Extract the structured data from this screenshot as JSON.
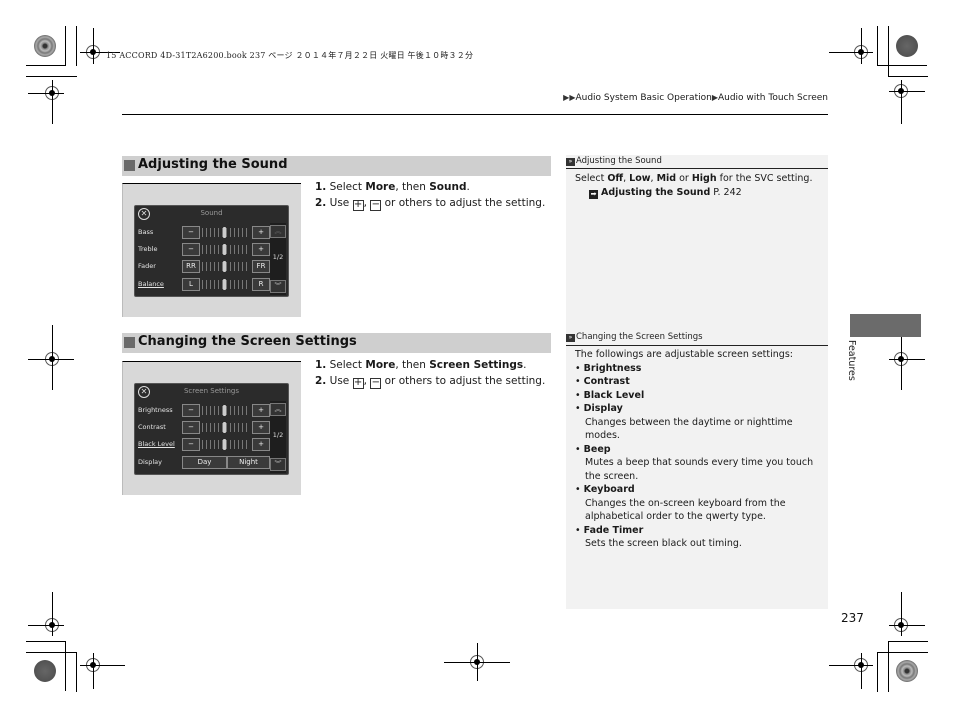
{
  "print_header": {
    "text": "15 ACCORD 4D-31T2A6200.book  237 ページ  ２０１４年７月２２日  火曜日  午後１０時３２分"
  },
  "breadcrumb": {
    "arrow": "▶",
    "items": [
      "Audio System Basic Operation",
      "Audio with Touch Screen"
    ]
  },
  "sections": [
    {
      "title": "Adjusting the Sound",
      "steps": [
        {
          "num": "1.",
          "pre": "Select ",
          "b1": "More",
          "mid": ", then ",
          "b2": "Sound",
          "post": "."
        },
        {
          "num": "2.",
          "pre": "Use ",
          "plus": "+",
          "sep": ", ",
          "minus": "−",
          "post": " or others to adjust the setting."
        }
      ],
      "screen": {
        "title": "Sound",
        "close_glyph": "✕",
        "rows": [
          {
            "label": "Bass",
            "left": "−",
            "right": "+"
          },
          {
            "label": "Treble",
            "left": "−",
            "right": "+"
          },
          {
            "label": "Fader",
            "left": "RR",
            "right": "FR"
          },
          {
            "label": "Balance",
            "left": "L",
            "right": "R"
          }
        ],
        "page": "1/2",
        "up": "︽",
        "down": "︾"
      }
    },
    {
      "title": "Changing the Screen Settings",
      "steps": [
        {
          "num": "1.",
          "pre": "Select ",
          "b1": "More",
          "mid": ", then ",
          "b2": "Screen Settings",
          "post": "."
        },
        {
          "num": "2.",
          "pre": "Use ",
          "plus": "+",
          "sep": ", ",
          "minus": "−",
          "post": " or others to adjust the setting."
        }
      ],
      "screen": {
        "title": "Screen Settings",
        "close_glyph": "✕",
        "rows": [
          {
            "label": "Brightness",
            "left": "−",
            "right": "+"
          },
          {
            "label": "Contrast",
            "left": "−",
            "right": "+"
          },
          {
            "label": "Black Level",
            "left": "−",
            "right": "+"
          }
        ],
        "display_row": {
          "label": "Display",
          "day": "Day",
          "night": "Night"
        },
        "page": "1/2",
        "up": "︽",
        "down": "︾"
      }
    }
  ],
  "notes": {
    "sound": {
      "head_icon": "»",
      "head": "Adjusting the Sound",
      "line_pre": "Select ",
      "opt1": "Off",
      "c1": ", ",
      "opt2": "Low",
      "c2": ", ",
      "opt3": "Mid",
      "c3": " or ",
      "opt4": "High",
      "line_post": " for the SVC setting.",
      "ref_icon": "➡",
      "ref_title": "Adjusting the Sound",
      "ref_page": " P. 242"
    },
    "screen": {
      "head_icon": "»",
      "head": "Changing the Screen Settings",
      "intro": "The followings are adjustable screen settings:",
      "bullet": "•",
      "items": [
        {
          "title": "Brightness",
          "desc": ""
        },
        {
          "title": "Contrast",
          "desc": ""
        },
        {
          "title": "Black Level",
          "desc": ""
        },
        {
          "title": "Display",
          "desc": "Changes between the daytime or nighttime modes."
        },
        {
          "title": "Beep",
          "desc": "Mutes a beep that sounds every time you touch the screen."
        },
        {
          "title": "Keyboard",
          "desc": "Changes the on-screen keyboard from the alphabetical order to the qwerty type."
        },
        {
          "title": "Fade Timer",
          "desc": "Sets the screen black out timing."
        }
      ]
    }
  },
  "side_tab": {
    "label": "Features"
  },
  "page_number": "237"
}
